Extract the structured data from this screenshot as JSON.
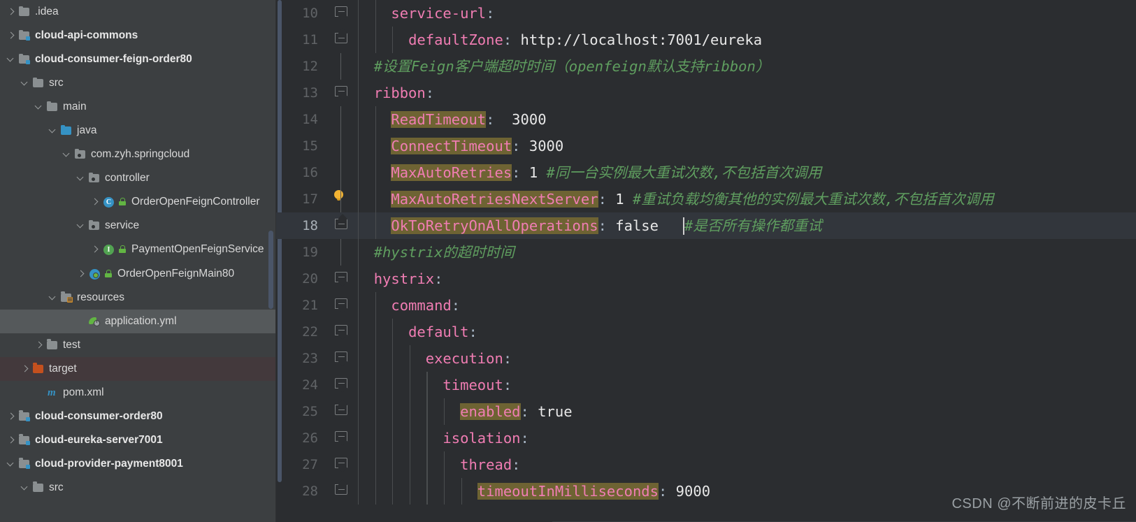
{
  "app": {
    "theme": "darcula",
    "colors": {
      "sidebar_bg": "#3c3f41",
      "editor_bg": "#2b2d30",
      "key_pink": "#f07db3",
      "comment_green": "#5f9e5f",
      "highlight_olive": "#6e6333",
      "current_line": "#32363c",
      "selection_gray": "#55595b",
      "accent_blue": "#3592c4",
      "folder_orange": "#c4501e",
      "bulb_yellow": "#f2b333"
    }
  },
  "sidebar": {
    "name": "project-tree",
    "scrollbar": "vertical-scrollbar",
    "items": [
      {
        "label": ".idea",
        "indent": 0,
        "arrow": "right",
        "icon": "folder-icon",
        "bold": false,
        "state": "normal"
      },
      {
        "label": "cloud-api-commons",
        "indent": 0,
        "arrow": "right",
        "icon": "module-folder-icon",
        "bold": true,
        "state": "normal"
      },
      {
        "label": "cloud-consumer-feign-order80",
        "indent": 0,
        "arrow": "down",
        "icon": "module-folder-icon",
        "bold": true,
        "state": "normal"
      },
      {
        "label": "src",
        "indent": 1,
        "arrow": "down",
        "icon": "folder-icon",
        "bold": false,
        "state": "normal"
      },
      {
        "label": "main",
        "indent": 2,
        "arrow": "down",
        "icon": "folder-icon",
        "bold": false,
        "state": "normal"
      },
      {
        "label": "java",
        "indent": 3,
        "arrow": "down",
        "icon": "source-folder-icon",
        "bold": false,
        "state": "normal"
      },
      {
        "label": "com.zyh.springcloud",
        "indent": 4,
        "arrow": "down",
        "icon": "package-icon",
        "bold": false,
        "state": "normal"
      },
      {
        "label": "controller",
        "indent": 5,
        "arrow": "down",
        "icon": "package-icon",
        "bold": false,
        "state": "normal"
      },
      {
        "label": "OrderOpenFeignController",
        "indent": 6,
        "arrow": "right",
        "icon": "java-class-icon",
        "bold": false,
        "state": "normal"
      },
      {
        "label": "service",
        "indent": 5,
        "arrow": "down",
        "icon": "package-icon",
        "bold": false,
        "state": "normal"
      },
      {
        "label": "PaymentOpenFeignService",
        "indent": 6,
        "arrow": "right",
        "icon": "java-interface-icon",
        "bold": false,
        "state": "normal"
      },
      {
        "label": "OrderOpenFeignMain80",
        "indent": 5,
        "arrow": "right",
        "icon": "spring-boot-icon",
        "bold": false,
        "state": "normal"
      },
      {
        "label": "resources",
        "indent": 3,
        "arrow": "down",
        "icon": "resources-folder-icon",
        "bold": false,
        "state": "normal"
      },
      {
        "label": "application.yml",
        "indent": 5,
        "arrow": "none",
        "icon": "spring-yaml-icon",
        "bold": false,
        "state": "selected"
      },
      {
        "label": "test",
        "indent": 2,
        "arrow": "right",
        "icon": "folder-icon",
        "bold": false,
        "state": "normal"
      },
      {
        "label": "target",
        "indent": 1,
        "arrow": "right",
        "icon": "excluded-folder-icon",
        "bold": false,
        "state": "target"
      },
      {
        "label": "pom.xml",
        "indent": 2,
        "arrow": "none",
        "icon": "maven-file-icon",
        "bold": false,
        "state": "normal"
      },
      {
        "label": "cloud-consumer-order80",
        "indent": 0,
        "arrow": "right",
        "icon": "module-folder-icon",
        "bold": true,
        "state": "normal"
      },
      {
        "label": "cloud-eureka-server7001",
        "indent": 0,
        "arrow": "right",
        "icon": "module-folder-icon",
        "bold": true,
        "state": "normal"
      },
      {
        "label": "cloud-provider-payment8001",
        "indent": 0,
        "arrow": "down",
        "icon": "module-folder-icon",
        "bold": true,
        "state": "normal"
      },
      {
        "label": "src",
        "indent": 1,
        "arrow": "down",
        "icon": "folder-icon",
        "bold": false,
        "state": "normal"
      }
    ]
  },
  "editor": {
    "name": "code-editor",
    "file": "application.yml",
    "language": "yaml",
    "first_visible_line": 10,
    "cursor_line": 18,
    "lines": [
      {
        "num": "10",
        "fold": "open",
        "bulb": false,
        "current": false,
        "tokens": [
          {
            "t": "    ",
            "c": "p"
          },
          {
            "t": "service-url",
            "c": "k"
          },
          {
            "t": ":",
            "c": "p"
          }
        ]
      },
      {
        "num": "11",
        "fold": "end",
        "bulb": false,
        "current": false,
        "tokens": [
          {
            "t": "      ",
            "c": "p"
          },
          {
            "t": "defaultZone",
            "c": "k"
          },
          {
            "t": ": ",
            "c": "p"
          },
          {
            "t": "http://localhost:7001/eureka",
            "c": "v"
          }
        ]
      },
      {
        "num": "12",
        "fold": "none",
        "bulb": false,
        "current": false,
        "tokens": [
          {
            "t": "  ",
            "c": "p"
          },
          {
            "t": "#设置Feign客户端超时时间（openfeign默认支持ribbon）",
            "c": "cm"
          }
        ]
      },
      {
        "num": "13",
        "fold": "open",
        "bulb": false,
        "current": false,
        "tokens": [
          {
            "t": "  ",
            "c": "p"
          },
          {
            "t": "ribbon",
            "c": "k"
          },
          {
            "t": ":",
            "c": "p"
          }
        ]
      },
      {
        "num": "14",
        "fold": "none",
        "bulb": false,
        "current": false,
        "tokens": [
          {
            "t": "    ",
            "c": "p"
          },
          {
            "t": "ReadTimeout",
            "c": "kh"
          },
          {
            "t": ":  ",
            "c": "p"
          },
          {
            "t": "3000",
            "c": "v"
          }
        ]
      },
      {
        "num": "15",
        "fold": "none",
        "bulb": false,
        "current": false,
        "tokens": [
          {
            "t": "    ",
            "c": "p"
          },
          {
            "t": "ConnectTimeout",
            "c": "kh"
          },
          {
            "t": ": ",
            "c": "p"
          },
          {
            "t": "3000",
            "c": "v"
          }
        ]
      },
      {
        "num": "16",
        "fold": "none",
        "bulb": false,
        "current": false,
        "tokens": [
          {
            "t": "    ",
            "c": "p"
          },
          {
            "t": "MaxAutoRetries",
            "c": "kh"
          },
          {
            "t": ": ",
            "c": "p"
          },
          {
            "t": "1",
            "c": "v"
          },
          {
            "t": " ",
            "c": "p"
          },
          {
            "t": "#同一台实例最大重试次数,不包括首次调用",
            "c": "cm"
          }
        ]
      },
      {
        "num": "17",
        "fold": "none",
        "bulb": true,
        "current": false,
        "tokens": [
          {
            "t": "    ",
            "c": "p"
          },
          {
            "t": "MaxAutoRetriesNextServer",
            "c": "kh"
          },
          {
            "t": ": ",
            "c": "p"
          },
          {
            "t": "1",
            "c": "v"
          },
          {
            "t": " ",
            "c": "p"
          },
          {
            "t": "#重试负载均衡其他的实例最大重试次数,不包括首次调用",
            "c": "cm"
          }
        ]
      },
      {
        "num": "18",
        "fold": "end",
        "bulb": false,
        "current": true,
        "tokens": [
          {
            "t": "    ",
            "c": "p"
          },
          {
            "t": "OkToRetryOnAllOperations",
            "c": "kh"
          },
          {
            "t": ": ",
            "c": "p"
          },
          {
            "t": "false",
            "c": "v"
          },
          {
            "t": "   ",
            "c": "p"
          },
          {
            "t": "#是否所有操作都重试",
            "c": "cm"
          }
        ]
      },
      {
        "num": "19",
        "fold": "none",
        "bulb": false,
        "current": false,
        "tokens": [
          {
            "t": "  ",
            "c": "p"
          },
          {
            "t": "#hystrix的超时时间",
            "c": "cm"
          }
        ]
      },
      {
        "num": "20",
        "fold": "open",
        "bulb": false,
        "current": false,
        "tokens": [
          {
            "t": "  ",
            "c": "p"
          },
          {
            "t": "hystrix",
            "c": "k"
          },
          {
            "t": ":",
            "c": "p"
          }
        ]
      },
      {
        "num": "21",
        "fold": "open",
        "bulb": false,
        "current": false,
        "tokens": [
          {
            "t": "    ",
            "c": "p"
          },
          {
            "t": "command",
            "c": "k"
          },
          {
            "t": ":",
            "c": "p"
          }
        ]
      },
      {
        "num": "22",
        "fold": "open",
        "bulb": false,
        "current": false,
        "tokens": [
          {
            "t": "      ",
            "c": "p"
          },
          {
            "t": "default",
            "c": "k"
          },
          {
            "t": ":",
            "c": "p"
          }
        ]
      },
      {
        "num": "23",
        "fold": "open",
        "bulb": false,
        "current": false,
        "tokens": [
          {
            "t": "        ",
            "c": "p"
          },
          {
            "t": "execution",
            "c": "k"
          },
          {
            "t": ":",
            "c": "p"
          }
        ]
      },
      {
        "num": "24",
        "fold": "open",
        "bulb": false,
        "current": false,
        "tokens": [
          {
            "t": "          ",
            "c": "p"
          },
          {
            "t": "timeout",
            "c": "k"
          },
          {
            "t": ":",
            "c": "p"
          }
        ]
      },
      {
        "num": "25",
        "fold": "end",
        "bulb": false,
        "current": false,
        "tokens": [
          {
            "t": "            ",
            "c": "p"
          },
          {
            "t": "enabled",
            "c": "kh"
          },
          {
            "t": ": ",
            "c": "p"
          },
          {
            "t": "true",
            "c": "v"
          }
        ]
      },
      {
        "num": "26",
        "fold": "open",
        "bulb": false,
        "current": false,
        "tokens": [
          {
            "t": "          ",
            "c": "p"
          },
          {
            "t": "isolation",
            "c": "k"
          },
          {
            "t": ":",
            "c": "p"
          }
        ]
      },
      {
        "num": "27",
        "fold": "open",
        "bulb": false,
        "current": false,
        "tokens": [
          {
            "t": "            ",
            "c": "p"
          },
          {
            "t": "thread",
            "c": "k"
          },
          {
            "t": ":",
            "c": "p"
          }
        ]
      },
      {
        "num": "28",
        "fold": "end",
        "bulb": false,
        "current": false,
        "tokens": [
          {
            "t": "              ",
            "c": "p"
          },
          {
            "t": "timeoutInMilliseconds",
            "c": "kh"
          },
          {
            "t": ": ",
            "c": "p"
          },
          {
            "t": "9000",
            "c": "v"
          }
        ]
      }
    ]
  },
  "watermark": {
    "text": "CSDN @不断前进的皮卡丘"
  }
}
